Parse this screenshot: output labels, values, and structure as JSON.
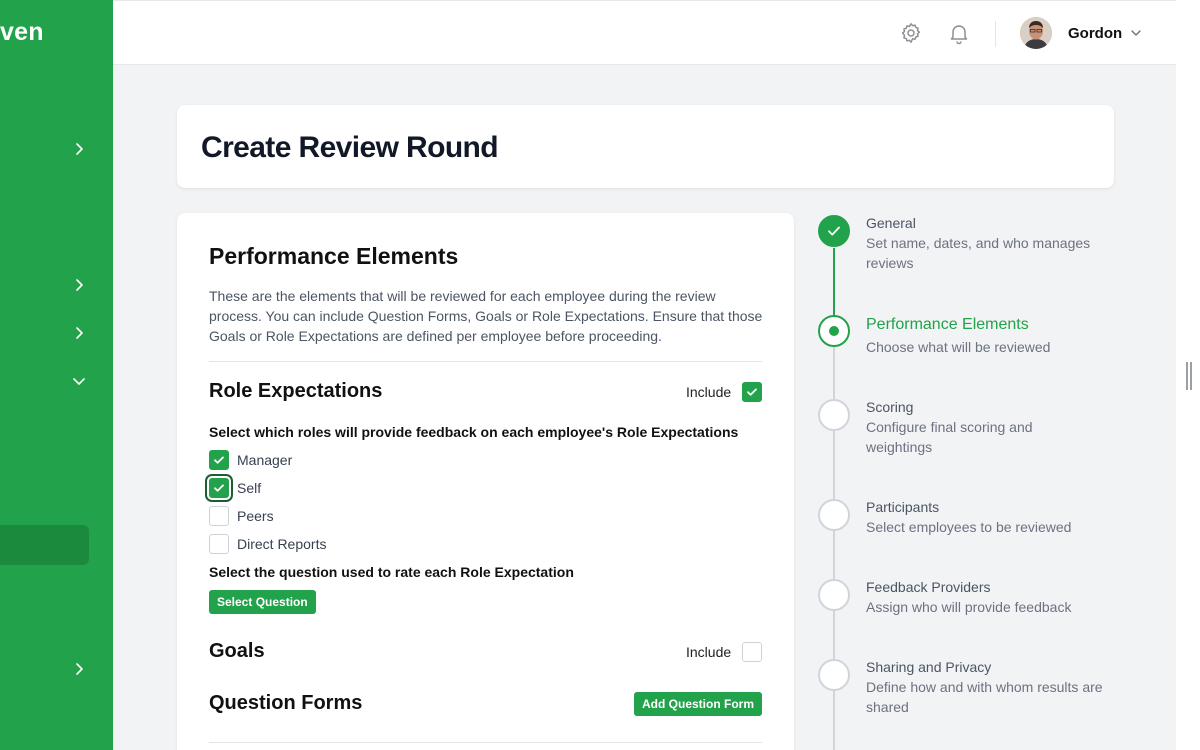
{
  "brand": "ven",
  "header": {
    "user_name": "Gordon"
  },
  "page": {
    "title": "Create Review Round"
  },
  "section": {
    "title": "Performance Elements",
    "description": "These are the elements that will be reviewed for each employee during the review process. You can include Question Forms, Goals or Role Expectations. Ensure that those Goals or Role Expectations are defined per employee before proceeding."
  },
  "role_expectations": {
    "title": "Role Expectations",
    "include_label": "Include",
    "include_checked": true,
    "roles_prompt": "Select which roles will provide feedback on each employee's Role Expectations",
    "roles": [
      {
        "label": "Manager",
        "checked": true
      },
      {
        "label": "Self",
        "checked": true
      },
      {
        "label": "Peers",
        "checked": false
      },
      {
        "label": "Direct Reports",
        "checked": false
      }
    ],
    "question_prompt": "Select the question used to rate each Role Expectation",
    "select_question_label": "Select Question"
  },
  "goals": {
    "title": "Goals",
    "include_label": "Include",
    "include_checked": false
  },
  "question_forms": {
    "title": "Question Forms",
    "add_label": "Add Question Form"
  },
  "steps": [
    {
      "title": "General",
      "desc": "Set name, dates, and who manages reviews",
      "state": "done"
    },
    {
      "title": "Performance Elements",
      "desc": "Choose what will be reviewed",
      "state": "current"
    },
    {
      "title": "Scoring",
      "desc": "Configure final scoring and weightings",
      "state": "pending"
    },
    {
      "title": "Participants",
      "desc": "Select employees to be reviewed",
      "state": "pending"
    },
    {
      "title": "Feedback Providers",
      "desc": "Assign who will provide feedback",
      "state": "pending"
    },
    {
      "title": "Sharing and Privacy",
      "desc": "Define how and with whom results are shared",
      "state": "pending"
    }
  ],
  "colors": {
    "brand_green": "#22a24a",
    "sidebar_active": "#1b8a3d"
  }
}
